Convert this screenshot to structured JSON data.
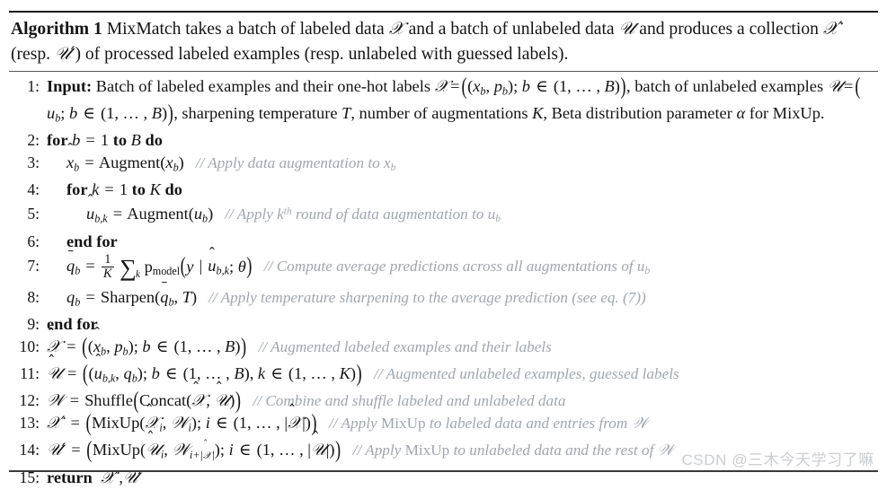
{
  "document": {
    "type": "algorithm-pseudocode-block",
    "background_color": "#ffffff",
    "text_color": "#141414",
    "comment_color": "#9fa6b0",
    "rule_color": "#1c1c1c"
  },
  "caption": {
    "label": "Algorithm 1",
    "text_part_1": "MixMatch takes a batch of labeled data ",
    "sym_X": "𝑳",
    "text_part_2": " and a batch of unlabeled data ",
    "sym_U": "𝒰",
    "text_part_3": " and produces a collection ",
    "sym_Xp": "𝑳′",
    "text_part_4": " (resp. ",
    "sym_Up": "𝒰′",
    "text_part_5": ") of processed labeled examples (resp. unlabeled with guessed labels).",
    "full_text": "Algorithm 1 MixMatch takes a batch of labeled data X and a batch of unlabeled data U and produces a collection X' (resp. U') of processed labeled examples (resp. unlabeled with guessed labels)."
  },
  "lines": [
    {
      "number": "1:",
      "indent": 0,
      "keyword": "Input:",
      "code": "Batch of labeled examples and their one-hot labels X = ((x_b, p_b); b ∈ (1,…,B)), batch of unlabeled examples U = (u_b; b ∈ (1,…,B)), sharpening temperature T, number of augmentations K, Beta distribution parameter α for MixUp.",
      "comment": ""
    },
    {
      "number": "2:",
      "indent": 0,
      "keyword": "for",
      "code": "b = 1 to B do",
      "comment": ""
    },
    {
      "number": "3:",
      "indent": 1,
      "keyword": "",
      "code": "x̂_b = Augment(x_b)",
      "comment": "// Apply data augmentation to x_b"
    },
    {
      "number": "4:",
      "indent": 1,
      "keyword": "for",
      "code": "k = 1 to K do",
      "comment": ""
    },
    {
      "number": "5:",
      "indent": 2,
      "keyword": "",
      "code": "û_{b,k} = Augment(u_b)",
      "comment": "// Apply k^th round of data augmentation to u_b"
    },
    {
      "number": "6:",
      "indent": 1,
      "keyword": "end for",
      "code": "",
      "comment": ""
    },
    {
      "number": "7:",
      "indent": 1,
      "keyword": "",
      "code": "q̄_b = (1/K) Σ_k p_model(y | û_{b,k}; θ)",
      "comment": "// Compute average predictions across all augmentations of u_b"
    },
    {
      "number": "8:",
      "indent": 1,
      "keyword": "",
      "code": "q_b = Sharpen(q̄_b, T)",
      "comment": "// Apply temperature sharpening to the average prediction (see eq. (7))"
    },
    {
      "number": "9:",
      "indent": 0,
      "keyword": "end for",
      "code": "",
      "comment": ""
    },
    {
      "number": "10:",
      "indent": 0,
      "keyword": "",
      "code": "X̂ = ((x̂_b, p_b); b ∈ (1,…,B))",
      "comment": "// Augmented labeled examples and their labels"
    },
    {
      "number": "11:",
      "indent": 0,
      "keyword": "",
      "code": "Û = ((û_{b,k}, q_b); b ∈ (1,…,B), k ∈ (1,…,K))",
      "comment": "// Augmented unlabeled examples, guessed labels"
    },
    {
      "number": "12:",
      "indent": 0,
      "keyword": "",
      "code": "W = Shuffle(Concat(X̂, Û))",
      "comment": "// Combine and shuffle labeled and unlabeled data"
    },
    {
      "number": "13:",
      "indent": 0,
      "keyword": "",
      "code": "X′ = (MixUp(X̂_i, W_i); i ∈ (1,…,|X̂|))",
      "comment": "// Apply MixUp to labeled data and entries from W"
    },
    {
      "number": "14:",
      "indent": 0,
      "keyword": "",
      "code": "U′ = (MixUp(Û_i, W_{i+|X̂|}); i ∈ (1,…,|Û|))",
      "comment": "// Apply MixUp to unlabeled data and the rest of W"
    },
    {
      "number": "15:",
      "indent": 0,
      "keyword": "return",
      "code": "X′, U′",
      "comment": ""
    }
  ],
  "line_numbers": {
    "n1": "1:",
    "n2": "2:",
    "n3": "3:",
    "n4": "4:",
    "n5": "5:",
    "n6": "6:",
    "n7": "7:",
    "n8": "8:",
    "n9": "9:",
    "n10": "10:",
    "n11": "11:",
    "n12": "12:",
    "n13": "13:",
    "n14": "14:",
    "n15": "15:"
  },
  "keywords": {
    "input": "Input:",
    "for": "for",
    "to": "to",
    "do": "do",
    "end_for": "end for",
    "return": "return"
  },
  "functions": {
    "augment": "Augment",
    "sharpen": "Sharpen",
    "shuffle": "Shuffle",
    "concat": "Concat",
    "mixup": "MixUp",
    "pmodel": "p",
    "pmodel_sub": "model"
  },
  "comments": {
    "c3": "// Apply data augmentation to x",
    "c3_sub": "b",
    "c5_a": "// Apply k",
    "c5_sup": "th",
    "c5_b": " round of data augmentation to u",
    "c5_sub": "b",
    "c7": "// Compute average predictions across all augmentations of u",
    "c7_sub": "b",
    "c8": "// Apply temperature sharpening to the average prediction (see eq. (7))",
    "c10": "// Augmented labeled examples and their labels",
    "c11": "// Augmented unlabeled examples, guessed labels",
    "c12": "// Combine and shuffle labeled and unlabeled data",
    "c13_a": "// Apply ",
    "c13_mixup": "MixUp",
    "c13_b": " to labeled data and entries from ",
    "c13_w": "𝒲",
    "c14_a": "// Apply ",
    "c14_mixup": "MixUp",
    "c14_b": " to unlabeled data and the rest of ",
    "c14_w": "𝒲"
  },
  "line1_text": {
    "part_a": "Batch of labeled examples and their one-hot labels",
    "part_b": ", batch of",
    "part_c": "unlabeled examples",
    "part_d": ", sharpening temperature",
    "part_e": ", number of augmentations",
    "part_f": ",",
    "part_g": "Beta distribution parameter",
    "part_h": "for MixUp.",
    "sym_T": "T",
    "sym_K": "K",
    "sym_alpha": "α"
  },
  "watermark": {
    "text": "CSDN @三木今天学习了嘛",
    "color": "#c9cdd2"
  }
}
